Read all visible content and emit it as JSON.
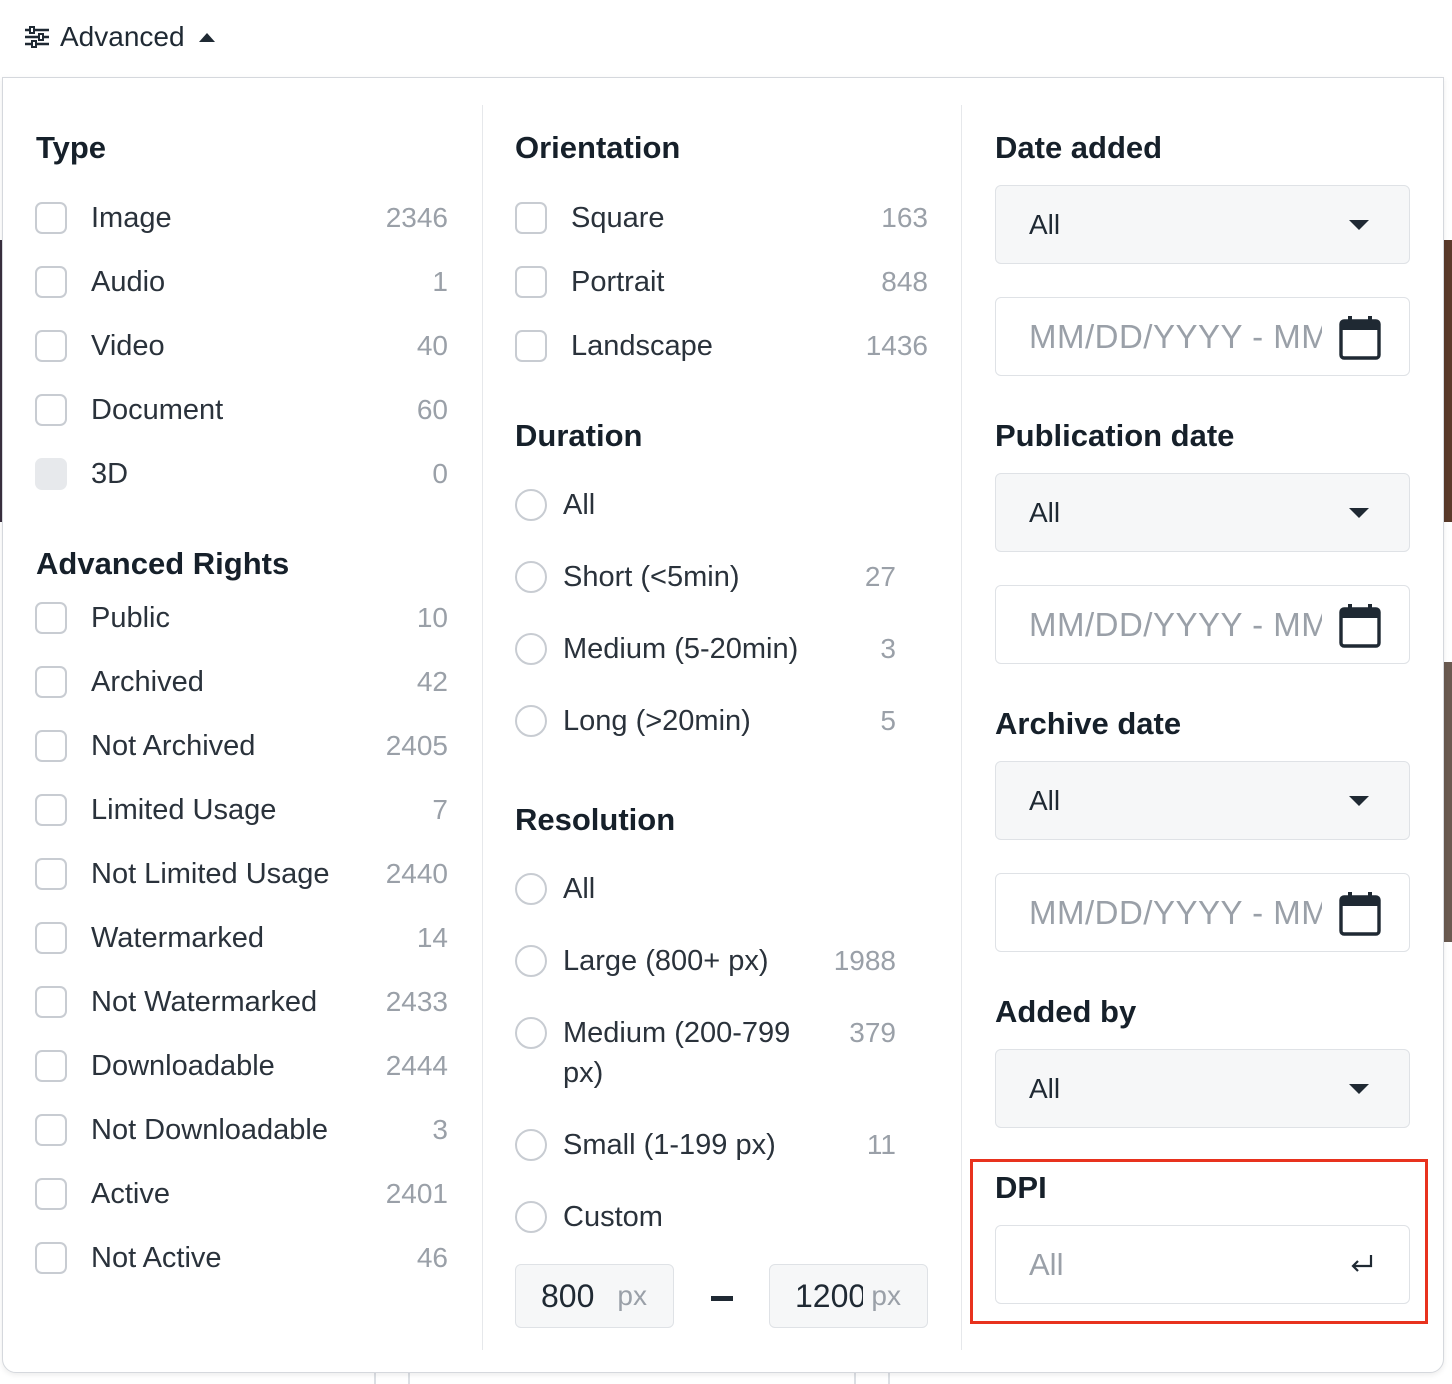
{
  "header": {
    "advanced_label": "Advanced"
  },
  "type": {
    "title": "Type",
    "items": [
      {
        "label": "Image",
        "count": "2346"
      },
      {
        "label": "Audio",
        "count": "1"
      },
      {
        "label": "Video",
        "count": "40"
      },
      {
        "label": "Document",
        "count": "60"
      },
      {
        "label": "3D",
        "count": "0",
        "disabled": true
      }
    ]
  },
  "advanced_rights": {
    "title": "Advanced Rights",
    "items": [
      {
        "label": "Public",
        "count": "10"
      },
      {
        "label": "Archived",
        "count": "42"
      },
      {
        "label": "Not Archived",
        "count": "2405"
      },
      {
        "label": "Limited Usage",
        "count": "7"
      },
      {
        "label": "Not Limited Usage",
        "count": "2440"
      },
      {
        "label": "Watermarked",
        "count": "14"
      },
      {
        "label": "Not Watermarked",
        "count": "2433"
      },
      {
        "label": "Downloadable",
        "count": "2444"
      },
      {
        "label": "Not Downloadable",
        "count": "3"
      },
      {
        "label": "Active",
        "count": "2401"
      },
      {
        "label": "Not Active",
        "count": "46"
      }
    ]
  },
  "orientation": {
    "title": "Orientation",
    "items": [
      {
        "label": "Square",
        "count": "163"
      },
      {
        "label": "Portrait",
        "count": "848"
      },
      {
        "label": "Landscape",
        "count": "1436"
      }
    ]
  },
  "duration": {
    "title": "Duration",
    "items": [
      {
        "label": "All",
        "count": ""
      },
      {
        "label": "Short (<5min)",
        "count": "27"
      },
      {
        "label": "Medium (5-20min)",
        "count": "3"
      },
      {
        "label": "Long (>20min)",
        "count": "5"
      }
    ]
  },
  "resolution": {
    "title": "Resolution",
    "items": [
      {
        "label": "All",
        "count": ""
      },
      {
        "label": "Large (800+ px)",
        "count": "1988"
      },
      {
        "label_line1": "Medium (200-799",
        "label_line2": "px)",
        "count": "379"
      },
      {
        "label": "Small (1-199 px)",
        "count": "11"
      },
      {
        "label": "Custom",
        "count": ""
      }
    ],
    "min_value": "800",
    "max_value": "1200",
    "unit": "px"
  },
  "date_added": {
    "title": "Date added",
    "select_value": "All",
    "range_placeholder": "MM/DD/YYYY - MM/DD/YYYY"
  },
  "publication_date": {
    "title": "Publication date",
    "select_value": "All",
    "range_placeholder": "MM/DD/YYYY - MM/DD/YYYY"
  },
  "archive_date": {
    "title": "Archive date",
    "select_value": "All",
    "range_placeholder": "MM/DD/YYYY - MM/DD/YYYY"
  },
  "added_by": {
    "title": "Added by",
    "select_value": "All"
  },
  "dpi": {
    "title": "DPI",
    "placeholder": "All"
  },
  "colors": {
    "highlight": "#e8321e",
    "checkbox_border": "#c8ccd2",
    "count_text": "#9aa0a8"
  }
}
